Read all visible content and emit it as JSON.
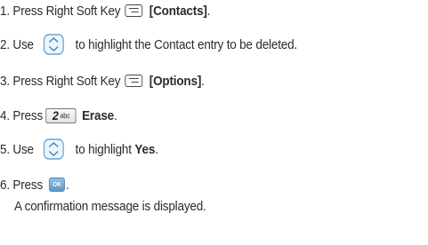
{
  "steps": [
    {
      "number": "1.",
      "before": "Press Right Soft Key",
      "icon": "right-soft-key-icon",
      "bold": "[Contacts]",
      "after": "."
    },
    {
      "number": "2.",
      "before": "Use",
      "icon": "navigation-key-icon",
      "after": "to highlight the Contact entry to be deleted."
    },
    {
      "number": "3.",
      "before": "Press Right Soft Key",
      "icon": "right-soft-key-icon",
      "bold": "[Options]",
      "after": "."
    },
    {
      "number": "4.",
      "before": "Press",
      "key_digit": "2",
      "key_letters": "abc",
      "bold": "Erase",
      "after": "."
    },
    {
      "number": "5.",
      "before": "Use",
      "icon": "navigation-key-icon",
      "after": "to highlight",
      "bold": "Yes",
      "after2": "."
    },
    {
      "number": "6.",
      "before": "Press",
      "key_label": "OK",
      "after": "."
    }
  ],
  "result_text": "A confirmation message is displayed.",
  "colors": {
    "text": "#2b2b2b",
    "ok_key": "#5b96c8",
    "nav_key": "#6aa3d3"
  }
}
